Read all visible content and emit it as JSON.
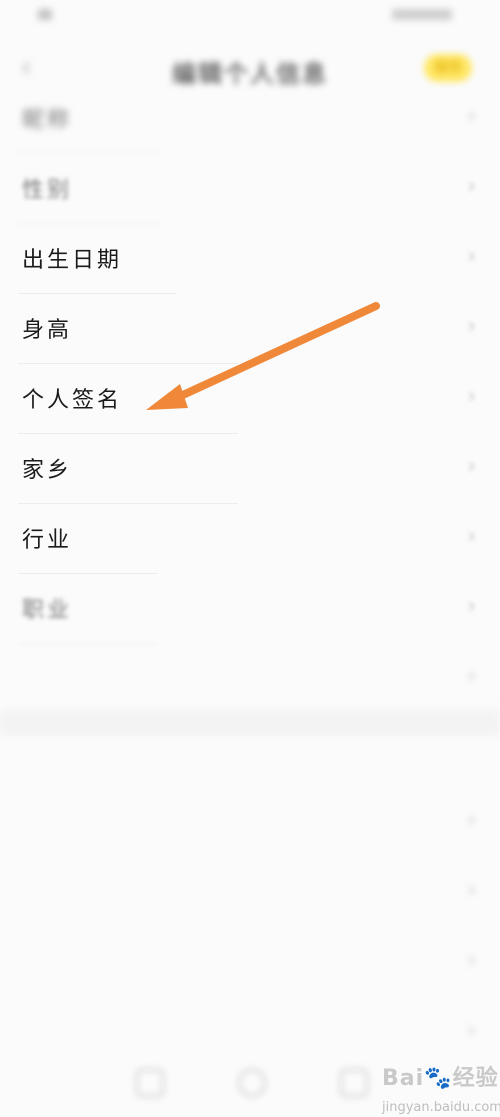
{
  "status_bar": {
    "left_text": "",
    "right_text": ""
  },
  "header": {
    "title": "编辑个人信息",
    "save_label": "保存"
  },
  "rows": [
    {
      "label": "昵称",
      "value": "",
      "style": "blur-hard"
    },
    {
      "label": "性别",
      "value": "",
      "style": "blur-soft"
    },
    {
      "label": "出生日期",
      "value": "",
      "style": "clear"
    },
    {
      "label": "身高",
      "value": "",
      "style": "clear"
    },
    {
      "label": "个人签名",
      "value": "",
      "style": "clear"
    },
    {
      "label": "家乡",
      "value": "",
      "style": "clear"
    },
    {
      "label": "行业",
      "value": "",
      "style": "clear"
    },
    {
      "label": "职业",
      "value": "",
      "style": "blur-soft"
    },
    {
      "label": "",
      "value": "",
      "style": "blur-hard"
    }
  ],
  "section": {
    "title": ""
  },
  "section_rows": [
    {
      "label": "",
      "value": ""
    },
    {
      "label": "",
      "value": ""
    },
    {
      "label": "",
      "value": ""
    },
    {
      "label": "",
      "value": ""
    }
  ],
  "watermark": {
    "brand": "Bai",
    "suffix": "经验",
    "sub": "jingyan.baidu.com"
  },
  "colors": {
    "arrow": "#f0883a",
    "save_bg": "#ffe766",
    "save_fg": "#e9bb1a"
  },
  "icons": {
    "back": "chevron-left-icon",
    "row_chevron": "chevron-right-icon"
  }
}
